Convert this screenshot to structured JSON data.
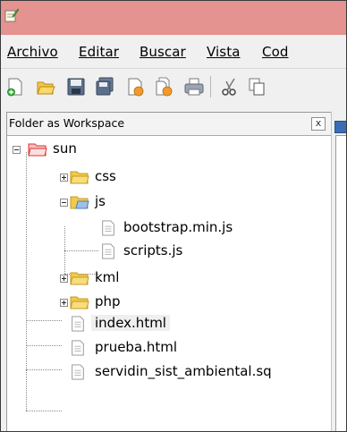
{
  "menubar": {
    "items": [
      "Archivo",
      "Editar",
      "Buscar",
      "Vista",
      "Cod"
    ]
  },
  "toolbar": {
    "buttons": [
      "new-file-icon",
      "open-file-icon",
      "save-icon",
      "save-all-icon",
      "close-file-icon",
      "close-all-icon",
      "print-icon",
      "cut-icon",
      "copy-icon"
    ]
  },
  "workspace_panel": {
    "title": "Folder as Workspace",
    "close_glyph": "x",
    "tree": {
      "root": "sun",
      "css": "css",
      "js": "js",
      "bootstrap": "bootstrap.min.js",
      "scripts": "scripts.js",
      "kml": "kml",
      "php": "php",
      "index": "index.html",
      "prueba": "prueba.html",
      "servidin": "servidin_sist_ambiental.sq"
    }
  },
  "colors": {
    "titlebar": "#e49390",
    "folder": "#f2c94c",
    "root_folder": "#e03b3b",
    "selection": "#efefef"
  }
}
